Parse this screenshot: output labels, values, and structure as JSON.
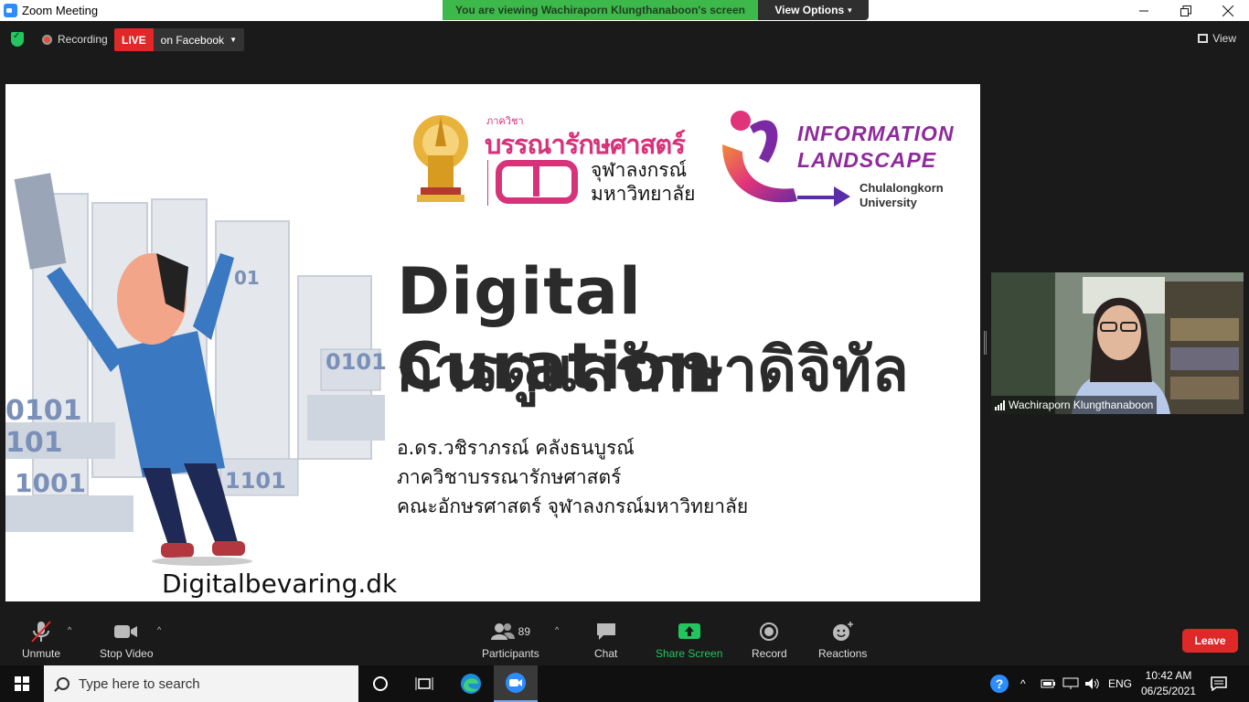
{
  "window": {
    "title": "Zoom Meeting",
    "controls": [
      "minimize",
      "restore",
      "close"
    ]
  },
  "share_banner": {
    "viewing_text": "You are viewing Wachiraporn Klungthanaboon's screen",
    "view_options_label": "View Options"
  },
  "meeting_bar": {
    "recording_label": "Recording",
    "live_badge": "LIVE",
    "live_target": "on Facebook",
    "view_label": "View"
  },
  "slide": {
    "dept_small": "ภาควิชา",
    "dept_name": "บรรณารักษศาสตร์",
    "university_line1": "จุฬาลงกรณ์",
    "university_line2": "มหาวิทยาลัย",
    "info_logo_line1": "INFORMATION",
    "info_logo_line2": "LANDSCAPE",
    "info_logo_line3": "Chulalongkorn",
    "info_logo_line4": "University",
    "title_en": "Digital Curation",
    "title_th": "การดูแลรักษาดิจิทัล",
    "lecturer_lines": [
      "อ.ดร.วชิราภรณ์ คลังธนบูรณ์",
      "ภาควิชาบรรณารักษศาสตร์",
      "คณะอักษรศาสตร์ จุฬาลงกรณ์มหาวิทยาลัย"
    ],
    "image_credit": "Digitalbevaring.dk"
  },
  "video_tile": {
    "participant_name": "Wachiraporn Klungthanaboon"
  },
  "controls": {
    "unmute_label": "Unmute",
    "stop_video_label": "Stop Video",
    "participants_label": "Participants",
    "participants_count": "89",
    "chat_label": "Chat",
    "share_screen_label": "Share Screen",
    "record_label": "Record",
    "reactions_label": "Reactions",
    "leave_label": "Leave"
  },
  "taskbar": {
    "search_placeholder": "Type here to search",
    "language": "ENG",
    "time": "10:42 AM",
    "date": "06/25/2021"
  },
  "colors": {
    "banner_green": "#3db84a",
    "live_red": "#e02828",
    "share_green": "#22c55e",
    "brand_pink": "#d6337a",
    "brand_purple": "#8e2a9b"
  }
}
